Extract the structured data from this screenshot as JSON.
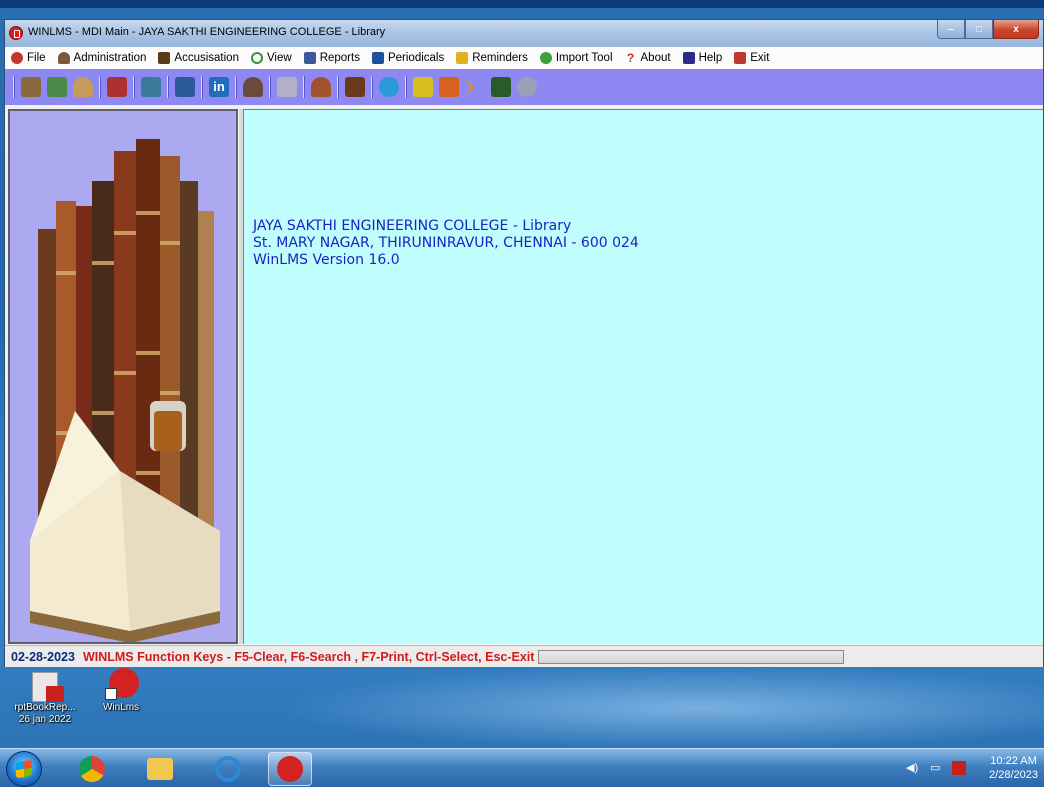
{
  "window": {
    "title": "WINLMS - MDI Main  - JAYA SAKTHI ENGINEERING COLLEGE - Library",
    "controls": {
      "minimize": "–",
      "maximize": "□",
      "close": "x"
    }
  },
  "menu": {
    "items": [
      {
        "label": "File",
        "icon": "file-icon",
        "color": "#c0392b"
      },
      {
        "label": "Administration",
        "icon": "admin-icon",
        "color": "#7a5a3a"
      },
      {
        "label": "Accusisation",
        "icon": "accusisation-icon",
        "color": "#5a3a1a"
      },
      {
        "label": "View",
        "icon": "view-icon",
        "color": "#3a8f3a"
      },
      {
        "label": "Reports",
        "icon": "reports-icon",
        "color": "#3a5a9a"
      },
      {
        "label": "Periodicals",
        "icon": "periodicals-icon",
        "color": "#1f4fa0"
      },
      {
        "label": "Reminders",
        "icon": "reminders-icon",
        "color": "#e0b020"
      },
      {
        "label": "Import Tool",
        "icon": "import-tool-icon",
        "color": "#3aa03a"
      },
      {
        "label": "About",
        "icon": "about-icon",
        "color": "#c0392b"
      },
      {
        "label": "Help",
        "icon": "help-icon",
        "color": "#2a2a8a"
      },
      {
        "label": "Exit",
        "icon": "exit-icon",
        "color": "#c0392b"
      }
    ]
  },
  "toolbar": {
    "colors": [
      "#8a6a3a",
      "#4a8a4a",
      "#c89a5a",
      "#b03030",
      "#3a7a9a",
      "#2a5a9a",
      "#1e6fb8",
      "#6a4a3a",
      "#b0b0c8",
      "#a0522d",
      "#6a3a1a",
      "#2a9ad8",
      "#d8c020",
      "#d86020",
      "#e09020",
      "#2a5a2a",
      "#9aa0b8"
    ]
  },
  "content": {
    "line1": "JAYA SAKTHI ENGINEERING COLLEGE - Library",
    "line2": "St. MARY NAGAR, THIRUNINRAVUR, CHENNAI - 600 024",
    "line3": "WinLMS Version 16.0"
  },
  "status": {
    "date": "02-28-2023",
    "keys": "WINLMS Function Keys - F5-Clear, F6-Search , F7-Print, Ctrl-Select, Esc-Exit"
  },
  "desktop_icons": [
    {
      "label": "rptBookRep...",
      "label2": "26 jan 2022"
    },
    {
      "label": "WinLms",
      "label2": ""
    }
  ],
  "taskbar": {
    "clock_time": "10:22 AM",
    "clock_date": "2/28/2023"
  }
}
